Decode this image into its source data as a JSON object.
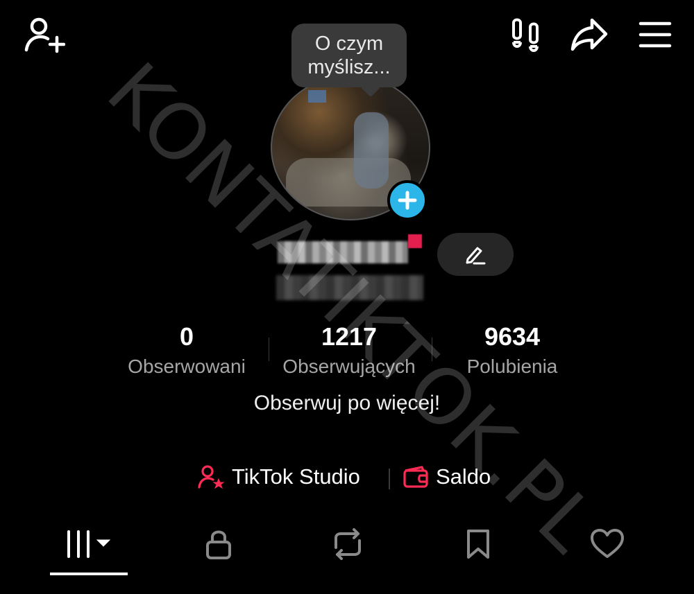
{
  "top_bar": {
    "add_friend_icon": "person-add-icon",
    "footprints_icon": "footprints-icon",
    "share_icon": "share-arrow-icon",
    "menu_icon": "hamburger-menu-icon"
  },
  "profile": {
    "bubble_text": "O czym myślisz...",
    "avatar_badge_icon": "plus-icon",
    "edit_icon": "pencil-icon"
  },
  "stats": [
    {
      "value": "0",
      "label": "Obserwowani"
    },
    {
      "value": "1217",
      "label": "Obserwujących"
    },
    {
      "value": "9634",
      "label": "Polubienia"
    }
  ],
  "hint_text": "Obserwuj po więcej!",
  "links": {
    "studio_label": "TikTok Studio",
    "studio_icon": "person-star-icon",
    "saldo_label": "Saldo",
    "saldo_icon": "wallet-icon"
  },
  "tabs": [
    {
      "name": "videos",
      "icon": "grid-bars-icon",
      "active": true
    },
    {
      "name": "private",
      "icon": "lock-icon"
    },
    {
      "name": "reposts",
      "icon": "repost-icon"
    },
    {
      "name": "saved",
      "icon": "bookmark-icon"
    },
    {
      "name": "liked",
      "icon": "heart-icon"
    }
  ],
  "watermark": "KONTATIKTOK.PL",
  "colors": {
    "background": "#000000",
    "accent_blue": "#2bb5e8",
    "accent_red": "#fe2c55",
    "muted_text": "#a6a6a6"
  }
}
